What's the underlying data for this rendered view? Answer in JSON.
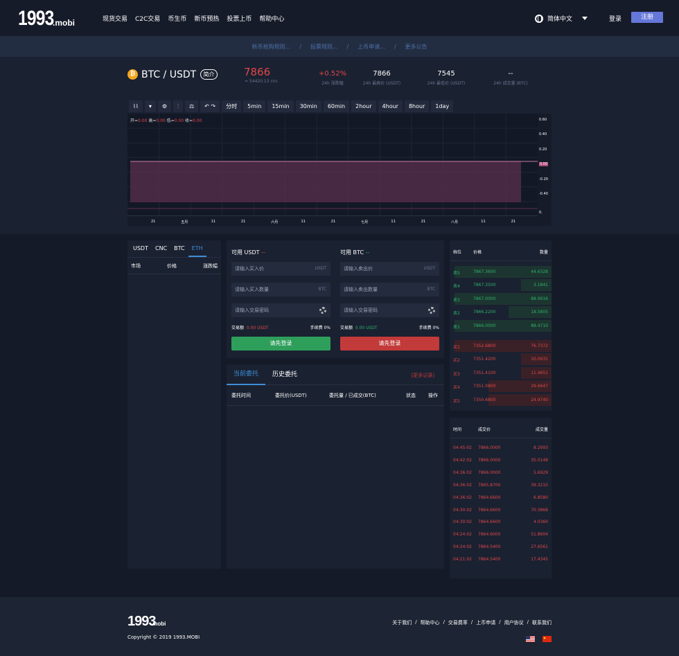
{
  "header": {
    "logo_main": "1993",
    "logo_sub": ".mobi",
    "nav": [
      "现货交易",
      "C2C交易",
      "币生币",
      "新币预热",
      "投票上币",
      "帮助中心"
    ],
    "language": "简体中文",
    "login": "登录",
    "register": "注册"
  },
  "notices": [
    "新币抢购规则...",
    "投票规则...",
    "上币申请...",
    "更多公告"
  ],
  "notice_sep": "/",
  "ticker": {
    "coin_symbol": "₿",
    "pair": "BTC / USDT",
    "intro": "简介",
    "price": "7866",
    "price_cny": "≈ 54420.13 cnc",
    "stats": [
      {
        "value": "+0.52%",
        "label": "24h 涨跌幅",
        "color": "#e04848"
      },
      {
        "value": "7866",
        "label": "24h 最高价 (USDT)",
        "color": "#ffffff"
      },
      {
        "value": "7545",
        "label": "24h 最低价 (USDT)",
        "color": "#ffffff"
      },
      {
        "value": "--",
        "label": "24h 成交量 (BTC)",
        "color": "#ffffff"
      }
    ]
  },
  "chart_toolbar": [
    "分时",
    "5min",
    "15min",
    "30min",
    "60min",
    "2hour",
    "4hour",
    "8hour",
    "1day"
  ],
  "chart_data": {
    "type": "area",
    "ohlc": {
      "open_label": "开=",
      "open": "0.00",
      "high_label": "高=",
      "high": "0.00",
      "low_label": "低=",
      "low": "0.00",
      "close_label": "收=",
      "close": "0.00"
    },
    "y_ticks": [
      "0.60",
      "0.40",
      "0.20",
      "0.00",
      "-0.20",
      "-0.40",
      "0."
    ],
    "current_value": "0.00",
    "x_ticks": [
      "21",
      "五月",
      "11",
      "21",
      "六月",
      "11",
      "21",
      "七月",
      "11",
      "21",
      "八月",
      "11",
      "21"
    ],
    "values": [
      0.0
    ],
    "fill_color": "#5a2f4f"
  },
  "market": {
    "tabs": [
      "USDT",
      "CNC",
      "BTC",
      "ETH"
    ],
    "active_tab": 3,
    "headers": [
      "市场",
      "价格",
      "涨跌幅"
    ]
  },
  "trade": {
    "buy": {
      "title": "可用 USDT",
      "avail": "--",
      "price_placeholder": "请输入买入价",
      "price_unit": "USDT",
      "amount_placeholder": "请输入买入数量",
      "amount_unit": "BTC",
      "password_placeholder": "请输入交易密码",
      "total_label": "交易额",
      "total": "0.00 USDT",
      "fee": "手续费 0%",
      "button": "请先登录"
    },
    "sell": {
      "title": "可用 BTC",
      "avail": "--",
      "price_placeholder": "请输入卖出价",
      "price_unit": "USDT",
      "amount_placeholder": "请输入卖出数量",
      "amount_unit": "BTC",
      "password_placeholder": "请输入交易密码",
      "total_label": "交易额",
      "total": "0.00 USDT",
      "fee": "手续费 0%",
      "button": "请先登录"
    }
  },
  "orders": {
    "tabs": [
      "当前委托",
      "历史委托"
    ],
    "more": "[更多记录]",
    "headers": [
      "委托时间",
      "委托价(USDT)",
      "委托量 / 已成交(BTC)",
      "状态",
      "操作"
    ]
  },
  "book": {
    "headers": [
      "档位",
      "价格",
      "数量"
    ],
    "sells": [
      {
        "label": "卖5",
        "price": "7867.3600",
        "qty": "44.6328",
        "depth": 0.95
      },
      {
        "label": "卖4",
        "price": "7867.3500",
        "qty": "3.1841",
        "depth": 0.3
      },
      {
        "label": "卖3",
        "price": "7867.0000",
        "qty": "88.9916",
        "depth": 0.95
      },
      {
        "label": "卖2",
        "price": "7866.2200",
        "qty": "18.5805",
        "depth": 0.42
      },
      {
        "label": "卖1",
        "price": "7866.0000",
        "qty": "88.4710",
        "depth": 0.95
      }
    ],
    "buys": [
      {
        "label": "买1",
        "price": "7352.6800",
        "qty": "76.7372",
        "depth": 0.95
      },
      {
        "label": "买2",
        "price": "7351.4200",
        "qty": "10.0931",
        "depth": 0.3
      },
      {
        "label": "买3",
        "price": "7351.4100",
        "qty": "11.4651",
        "depth": 0.3
      },
      {
        "label": "买4",
        "price": "7351.0800",
        "qty": "29.6647",
        "depth": 0.62
      },
      {
        "label": "买5",
        "price": "7350.6800",
        "qty": "24.9740",
        "depth": 0.62
      }
    ]
  },
  "trades": {
    "headers": [
      "时间",
      "成交价",
      "成交量"
    ],
    "rows": [
      [
        "04:45:02",
        "7866.0000",
        "8.2993"
      ],
      [
        "04:42:02",
        "7866.0000",
        "35.0148"
      ],
      [
        "04:36:02",
        "7866.0000",
        "5.6929"
      ],
      [
        "04:36:02",
        "7865.8700",
        "39.3210"
      ],
      [
        "04:36:02",
        "7864.6600",
        "6.8580"
      ],
      [
        "04:30:02",
        "7864.6600",
        "70.3868"
      ],
      [
        "04:30:02",
        "7864.6600",
        "4.0360"
      ],
      [
        "04:24:02",
        "7864.6000",
        "51.8904"
      ],
      [
        "04:24:02",
        "7864.5400",
        "27.6561"
      ],
      [
        "04:21:02",
        "7864.5400",
        "17.4345"
      ]
    ]
  },
  "footer": {
    "logo_main": "1993",
    "logo_sub": ".mobi",
    "copyright": "Copyright © 2019 1993.MOBI",
    "links": [
      "关于我们",
      "帮助中心",
      "交易费率",
      "上币申请",
      "用户协议",
      "联系我们"
    ],
    "link_sep": "/"
  },
  "colors": {
    "accent": "#6577d9",
    "buy_green": "#2db36b",
    "sell_red": "#c23a3a",
    "up_red": "#e04848",
    "active_blue": "#3e8ed6"
  }
}
